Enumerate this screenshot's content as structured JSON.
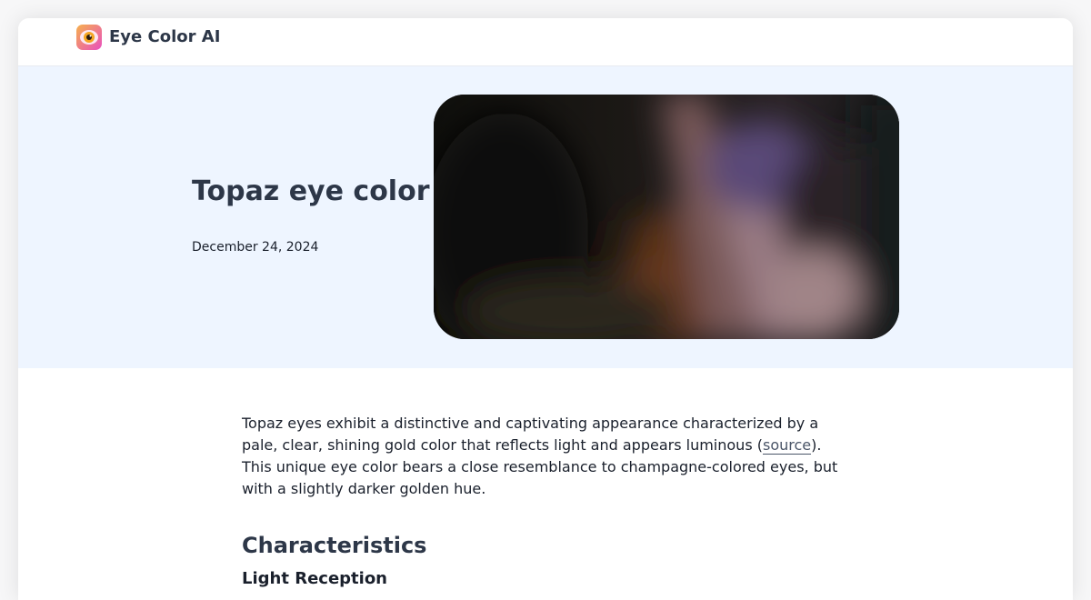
{
  "header": {
    "brand_name": "Eye Color AI",
    "logo_icon": "eye-logo-icon"
  },
  "hero": {
    "title": "Topaz eye color",
    "date": "December 24, 2024",
    "image_alt": "Topaz eye close-up"
  },
  "article": {
    "intro_part1": "Topaz eyes exhibit a distinctive and captivating appearance characterized by a pale, clear, shining gold color that reflects light and appears luminous (",
    "source_link": "source",
    "intro_part2": "). This unique eye color bears a close resemblance to champagne-colored eyes, but with a slightly darker golden hue.",
    "section_heading": "Characteristics",
    "subheading": "Light Reception"
  },
  "colors": {
    "hero_background": "#eef5ff",
    "heading_text": "#2d3748",
    "body_text": "#1a202c",
    "logo_gradient_start": "#f6b04b",
    "logo_gradient_end": "#e94fc0"
  }
}
